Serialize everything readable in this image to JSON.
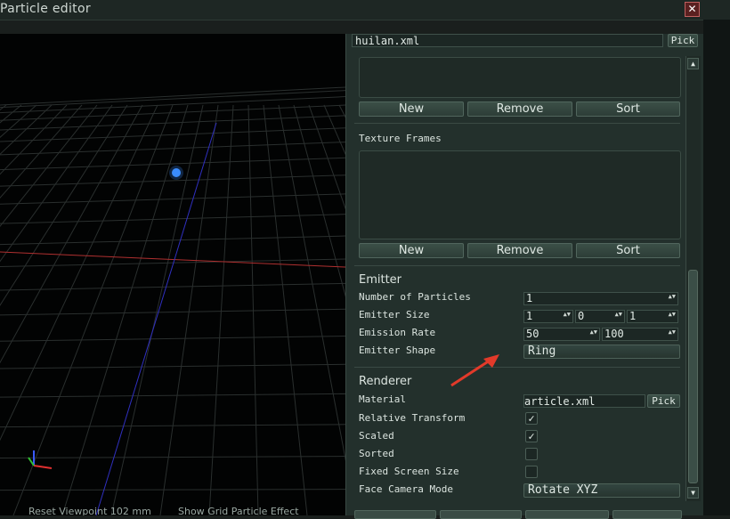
{
  "window": {
    "title": "Particle editor",
    "close_glyph": "✕"
  },
  "file": {
    "name": "huilan.xml",
    "pick_label": "Pick"
  },
  "list1_buttons": {
    "new": "New",
    "remove": "Remove",
    "sort": "Sort"
  },
  "texture_frames": {
    "label": "Texture Frames",
    "new": "New",
    "remove": "Remove",
    "sort": "Sort"
  },
  "emitter": {
    "heading": "Emitter",
    "num_particles_label": "Number of Particles",
    "num_particles": "1",
    "size_label": "Emitter Size",
    "size_x": "1",
    "size_y": "0",
    "size_z": "1",
    "rate_label": "Emission Rate",
    "rate_min": "50",
    "rate_max": "100",
    "shape_label": "Emitter Shape",
    "shape": "Ring"
  },
  "renderer": {
    "heading": "Renderer",
    "material_label": "Material",
    "material": "article.xml",
    "material_pick": "Pick",
    "relative_transform_label": "Relative Transform",
    "relative_transform": true,
    "scaled_label": "Scaled",
    "scaled": true,
    "sorted_label": "Sorted",
    "sorted": false,
    "fixed_size_label": "Fixed Screen Size",
    "fixed_size": false,
    "face_camera_label": "Face Camera Mode",
    "face_camera": "Rotate XYZ"
  },
  "viewport_status": {
    "left": "Reset Viewpoint  102 mm",
    "right": "Show Grid   Particle Effect"
  },
  "icons": {
    "scroll_up": "▲",
    "scroll_down": "▼",
    "check": "✓",
    "spin": "▲▼"
  },
  "colors": {
    "panel_bg": "#23302c",
    "viewport_bg": "#020303",
    "grid": "#2a2f2e",
    "x_axis": "#b03030",
    "y_axis": "#3030c0",
    "particle": "#3a8cff",
    "arrow": "#e23a2a"
  }
}
